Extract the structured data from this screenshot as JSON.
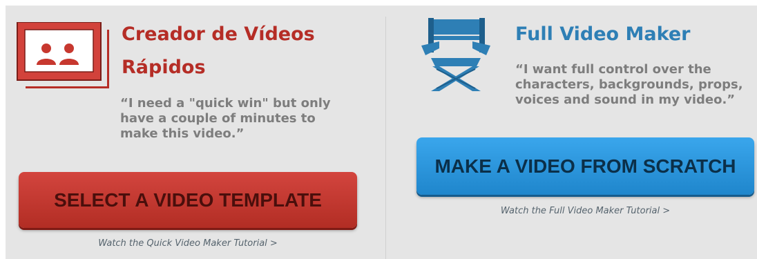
{
  "quick": {
    "title": "Creador de Vídeos Rápidos",
    "quote": "“I need a \"quick win\" but only have a couple of minutes to make this video.”",
    "button_label": "SELECT A VIDEO TEMPLATE",
    "tutorial_link": "Watch the Quick Video Maker Tutorial >",
    "icon": "people-cards-icon",
    "accent": "#b52d26"
  },
  "full": {
    "title": "Full Video Maker",
    "quote": "“I want full control over the characters, backgrounds, props, voices and sound in my video.”",
    "button_label": "MAKE A VIDEO FROM SCRATCH",
    "tutorial_link": "Watch the Full Video Maker Tutorial >",
    "icon": "director-chair-icon",
    "accent": "#2e7fb5"
  }
}
